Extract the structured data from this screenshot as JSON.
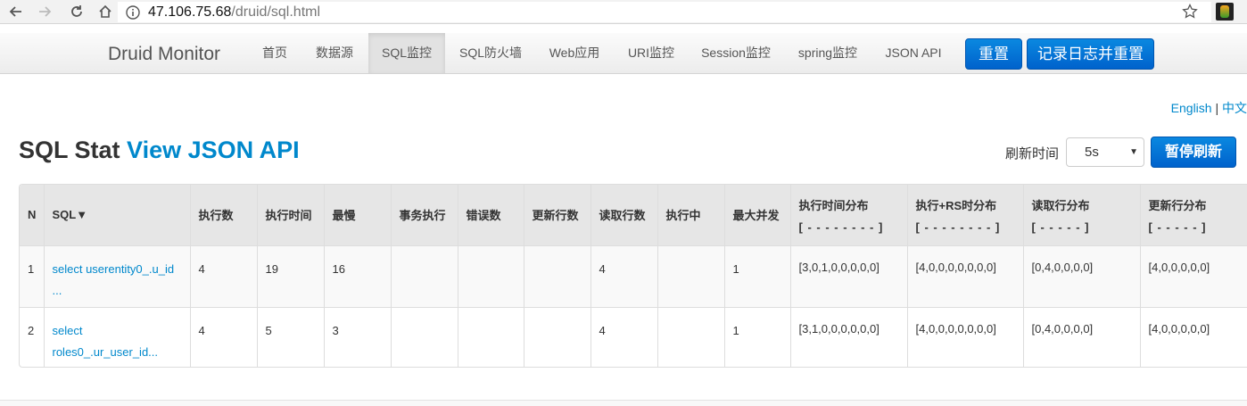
{
  "browser": {
    "url_host": "47.106.75.68",
    "url_path": "/druid/sql.html"
  },
  "navbar": {
    "brand": "Druid Monitor",
    "items": [
      {
        "label": "首页",
        "active": false
      },
      {
        "label": "数据源",
        "active": false
      },
      {
        "label": "SQL监控",
        "active": true
      },
      {
        "label": "SQL防火墙",
        "active": false
      },
      {
        "label": "Web应用",
        "active": false
      },
      {
        "label": "URI监控",
        "active": false
      },
      {
        "label": "Session监控",
        "active": false
      },
      {
        "label": "spring监控",
        "active": false
      },
      {
        "label": "JSON API",
        "active": false
      }
    ],
    "reset_label": "重置",
    "log_reset_label": "记录日志并重置"
  },
  "lang": {
    "english": "English",
    "sep": "|",
    "chinese": "中文"
  },
  "title": {
    "prefix": "SQL Stat",
    "link": "View JSON API"
  },
  "refresh": {
    "label": "刷新时间",
    "selected": "5s",
    "pause_label": "暂停刷新"
  },
  "table": {
    "headers": [
      "N",
      "SQL▼",
      "执行数",
      "执行时间",
      "最慢",
      "事务执行",
      "错误数",
      "更新行数",
      "读取行数",
      "执行中",
      "最大并发"
    ],
    "dist_headers": [
      {
        "label": "执行时间分布",
        "sub": "[ - - - - - - - - ]"
      },
      {
        "label": "执行+RS时分布",
        "sub": "[ - - - - - - - - ]"
      },
      {
        "label": "读取行分布",
        "sub": "[ - - - - - ]"
      },
      {
        "label": "更新行分布",
        "sub": "[ - - - - - ]"
      }
    ],
    "rows": [
      {
        "n": "1",
        "sql_line1": "select userentity0_.u_id",
        "sql_line2": "...",
        "exec": "4",
        "time": "19",
        "slowest": "16",
        "txn": "",
        "errors": "",
        "updated": "",
        "read": "4",
        "running": "",
        "concurrent": "1",
        "dist1": "[3,0,1,0,0,0,0,0]",
        "dist2": "[4,0,0,0,0,0,0,0]",
        "dist3": "[0,4,0,0,0,0]",
        "dist4": "[4,0,0,0,0,0]"
      },
      {
        "n": "2",
        "sql_line1": "select",
        "sql_line2": "roles0_.ur_user_id...",
        "exec": "4",
        "time": "5",
        "slowest": "3",
        "txn": "",
        "errors": "",
        "updated": "",
        "read": "4",
        "running": "",
        "concurrent": "1",
        "dist1": "[3,1,0,0,0,0,0,0]",
        "dist2": "[4,0,0,0,0,0,0,0]",
        "dist3": "[0,4,0,0,0,0]",
        "dist4": "[4,0,0,0,0,0]"
      }
    ]
  }
}
